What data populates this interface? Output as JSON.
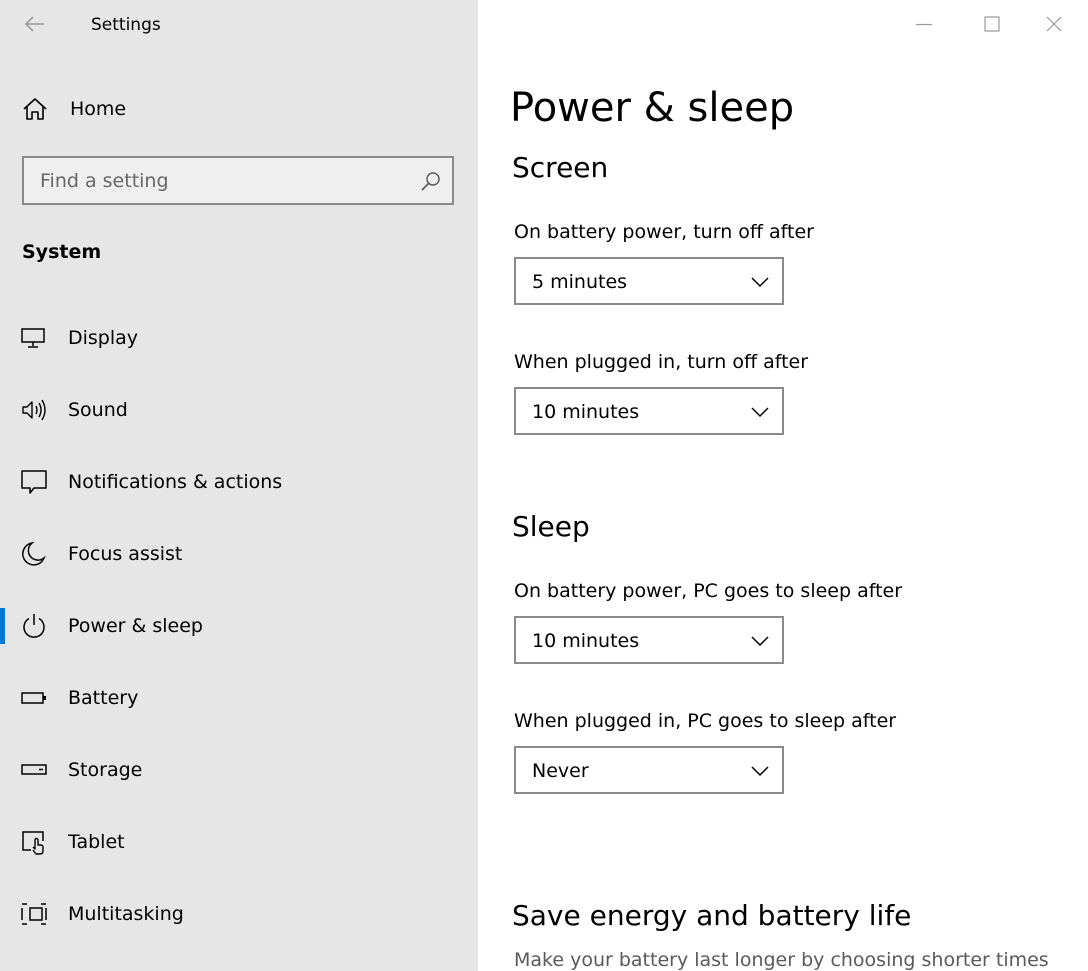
{
  "window": {
    "title": "Settings"
  },
  "sidebar": {
    "home_label": "Home",
    "search_placeholder": "Find a setting",
    "search_value": "",
    "section_label": "System",
    "items": [
      {
        "label": "Display",
        "icon": "monitor-icon",
        "selected": false
      },
      {
        "label": "Sound",
        "icon": "speaker-icon",
        "selected": false
      },
      {
        "label": "Notifications & actions",
        "icon": "notification-icon",
        "selected": false
      },
      {
        "label": "Focus assist",
        "icon": "moon-icon",
        "selected": false
      },
      {
        "label": "Power & sleep",
        "icon": "power-icon",
        "selected": true
      },
      {
        "label": "Battery",
        "icon": "battery-icon",
        "selected": false
      },
      {
        "label": "Storage",
        "icon": "storage-icon",
        "selected": false
      },
      {
        "label": "Tablet",
        "icon": "tablet-icon",
        "selected": false
      },
      {
        "label": "Multitasking",
        "icon": "multitasking-icon",
        "selected": false
      }
    ]
  },
  "main": {
    "page_title": "Power & sleep",
    "screen": {
      "title": "Screen",
      "battery_label": "On battery power, turn off after",
      "battery_value": "5 minutes",
      "plugged_label": "When plugged in, turn off after",
      "plugged_value": "10 minutes"
    },
    "sleep": {
      "title": "Sleep",
      "battery_label": "On battery power, PC goes to sleep after",
      "battery_value": "10 minutes",
      "plugged_label": "When plugged in, PC goes to sleep after",
      "plugged_value": "Never"
    },
    "save_energy": {
      "title": "Save energy and battery life",
      "description": "Make your battery last longer by choosing shorter times"
    }
  },
  "colors": {
    "accent": "#0078d7",
    "sidebar_bg": "#e6e6e6",
    "border": "#8a8a8a"
  }
}
